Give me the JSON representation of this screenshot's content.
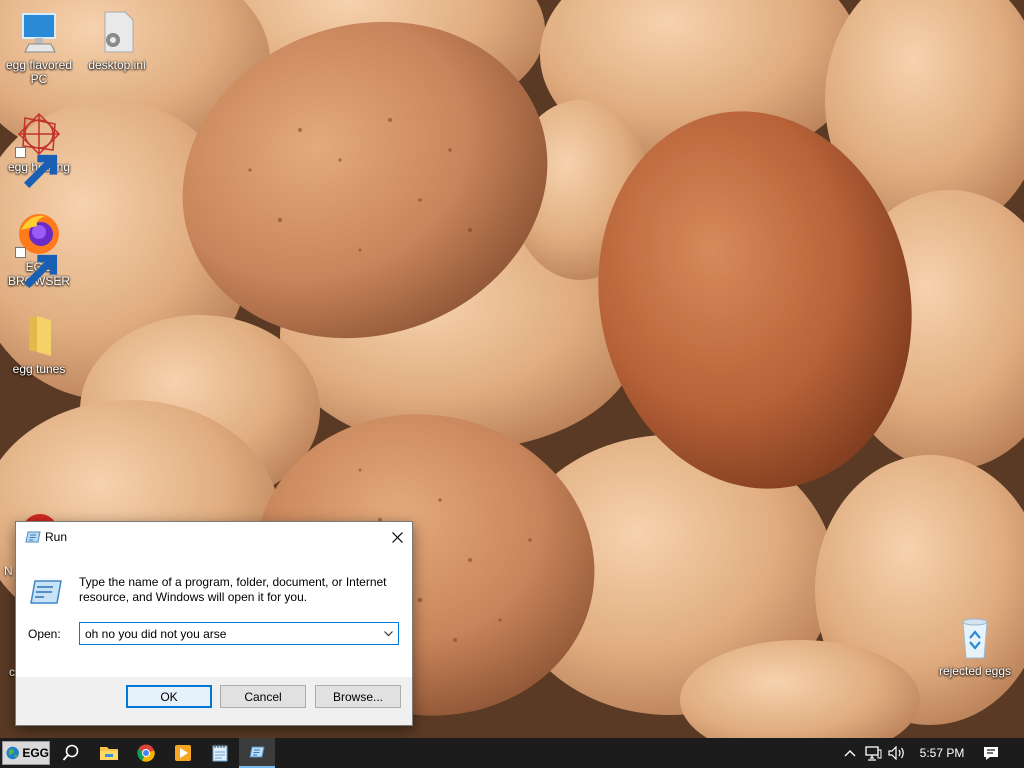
{
  "desktop": {
    "icons": [
      {
        "label": "egg flavored PC",
        "icon": "computer-icon"
      },
      {
        "label": "desktop.ini",
        "icon": "settings-file-icon"
      },
      {
        "label": "egg hosting",
        "icon": "web-hosting-icon"
      },
      {
        "label": "EGG BROWSER",
        "icon": "firefox-icon"
      },
      {
        "label": "egg tunes",
        "icon": "folder-icon"
      },
      {
        "label": "N",
        "icon": "red-app-icon"
      },
      {
        "label": "c",
        "icon": "unknown-icon"
      },
      {
        "label": "rejected eggs",
        "icon": "recycle-bin-icon"
      }
    ]
  },
  "run_dialog": {
    "title": "Run",
    "description": "Type the name of a program, folder, document, or Internet resource, and Windows will open it for you.",
    "open_label": "Open:",
    "open_value": "oh no you did not you arse",
    "ok_label": "OK",
    "cancel_label": "Cancel",
    "browse_label": "Browse..."
  },
  "taskbar": {
    "start_label": "EGG",
    "pinned": [
      "search-icon",
      "file-explorer-icon",
      "chrome-icon",
      "media-player-icon",
      "notepad-icon",
      "run-icon"
    ],
    "clock": "5:57 PM",
    "tray": [
      "chevron-up-icon",
      "network-icon",
      "volume-icon",
      "notification-icon"
    ]
  },
  "colors": {
    "accent": "#0078d7",
    "taskbar_bg": "#1c1c1c",
    "dialog_bg": "#f0f0f0"
  }
}
